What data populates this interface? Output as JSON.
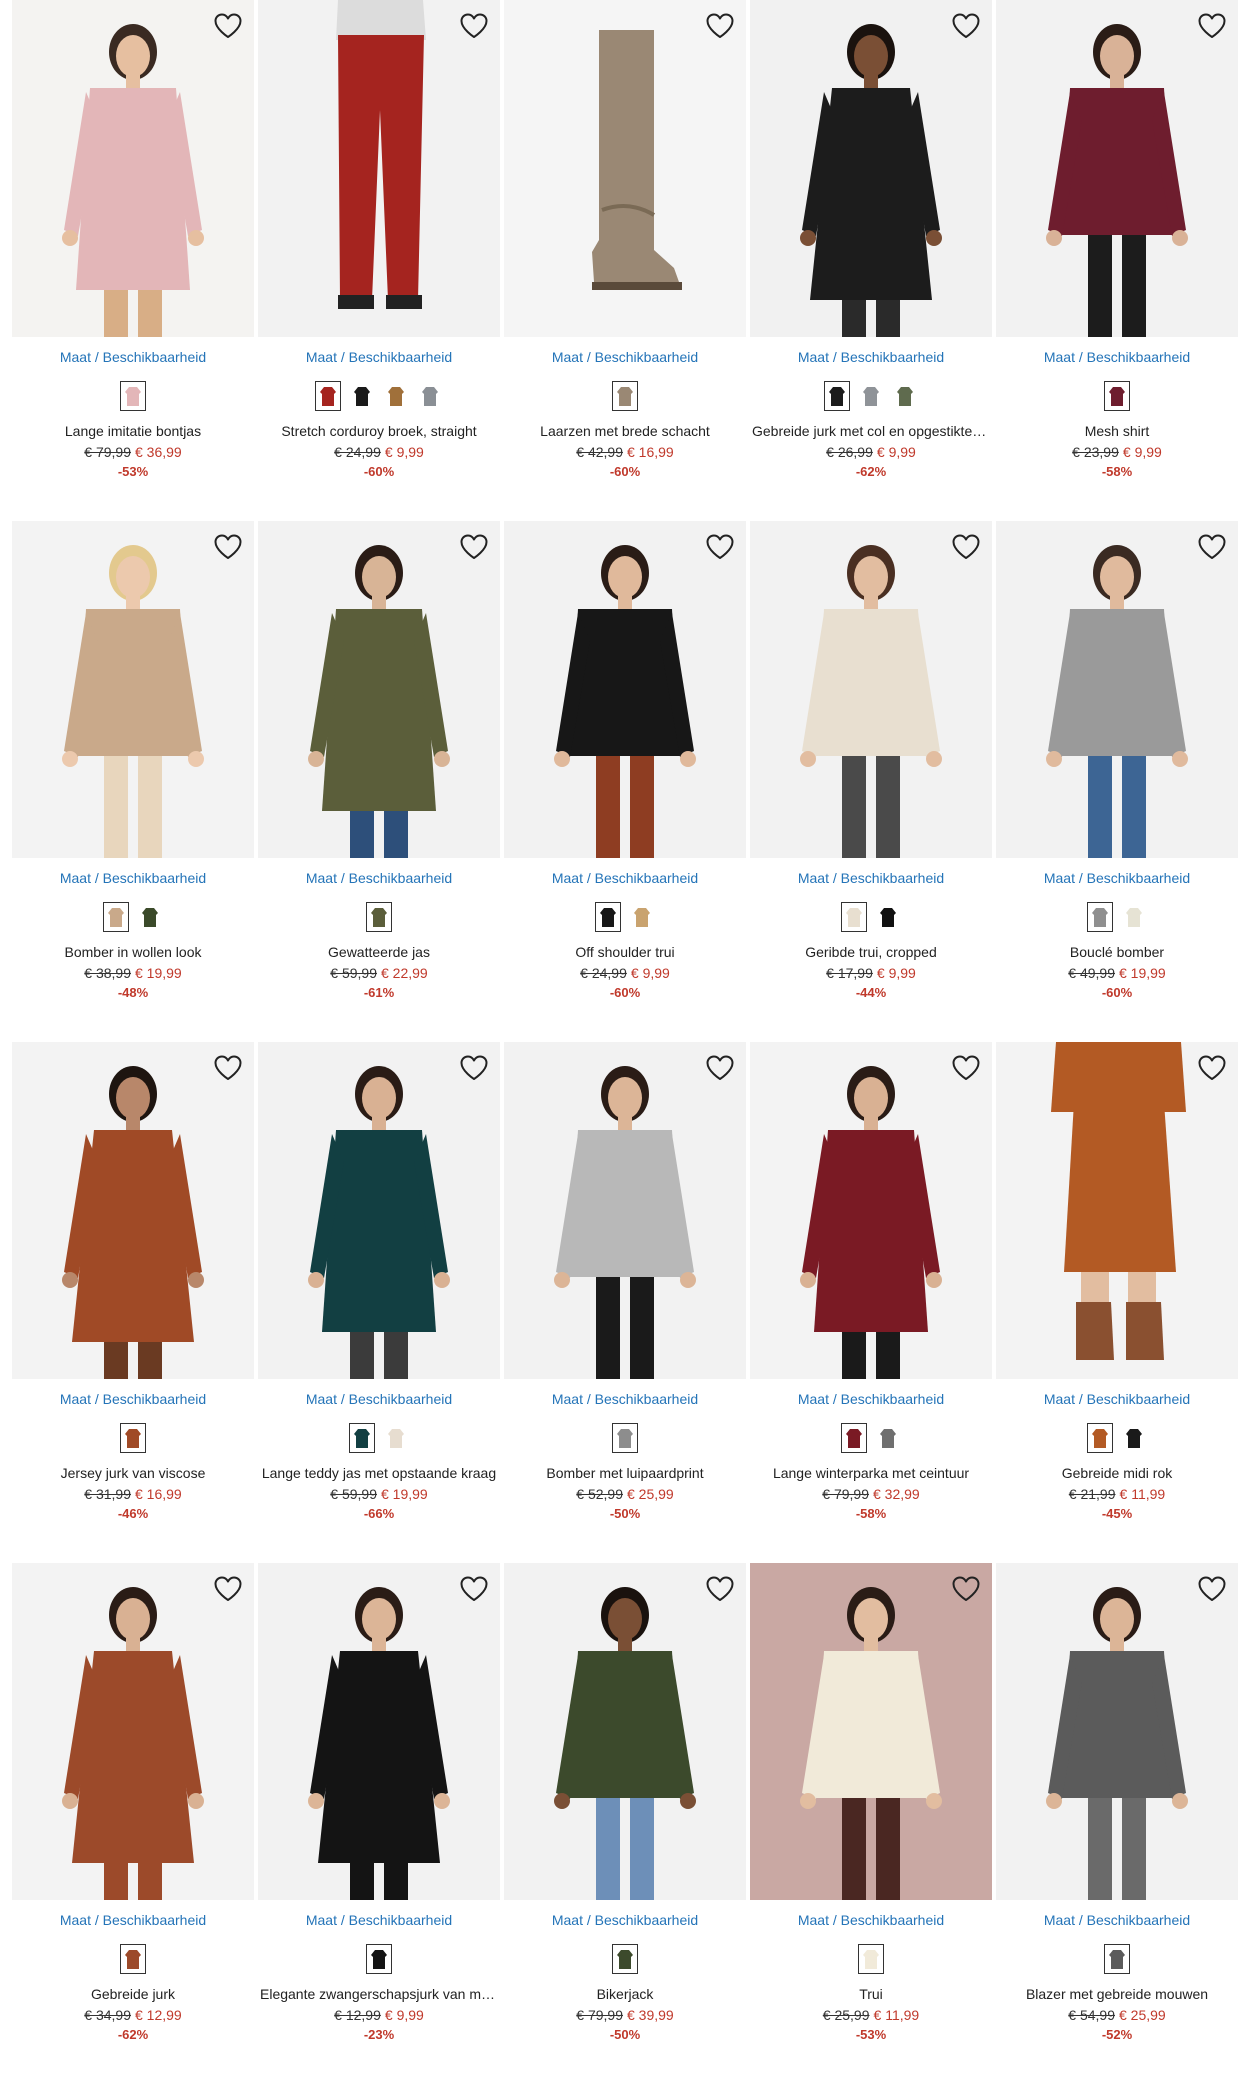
{
  "labels": {
    "sizes_link": "Maat / Beschikbaarheid"
  },
  "icons": {
    "wishlist": "heart-outline-icon"
  },
  "colors": {
    "link": "#2474b8",
    "sale": "#c0392b"
  },
  "products": [
    {
      "name": "Lange imitatie bontjas",
      "old_price": "€ 79,99",
      "new_price": "€ 36,99",
      "discount": "-53%",
      "bg": "#f4f3f1",
      "figure": "#e3b6b8",
      "legs": "#d8ae86",
      "skin": "#e6bfa0",
      "hair": "#3a2a22",
      "kind": "coat",
      "swatches": [
        "#e3b6b8"
      ]
    },
    {
      "name": "Stretch corduroy broek, straight",
      "old_price": "€ 24,99",
      "new_price": "€ 9,99",
      "discount": "-60%",
      "bg": "#f2f2f2",
      "figure": "#a5241f",
      "legs": "#a5241f",
      "skin": "#e2bfa3",
      "hair": "#2a2a2a",
      "kind": "pants",
      "swatches": [
        "#a5241f",
        "#1a1a1a",
        "#a0703a",
        "#8a8f95"
      ]
    },
    {
      "name": "Laarzen met brede schacht",
      "old_price": "€ 42,99",
      "new_price": "€ 16,99",
      "discount": "-60%",
      "bg": "#f5f5f5",
      "figure": "#9a8874",
      "legs": "#9a8874",
      "skin": "#9a8874",
      "hair": "#9a8874",
      "kind": "boot",
      "swatches": [
        "#9a8874"
      ]
    },
    {
      "name": "Gebreide jurk met col en opgestikte zak",
      "old_price": "€ 26,99",
      "new_price": "€ 9,99",
      "discount": "-62%",
      "bg": "#f1f1f1",
      "figure": "#1c1c1c",
      "legs": "#2a2a2a",
      "skin": "#7a4f35",
      "hair": "#1a120e",
      "kind": "dress",
      "swatches": [
        "#1c1c1c",
        "#8f9398",
        "#5f6b4e"
      ]
    },
    {
      "name": "Mesh shirt",
      "old_price": "€ 23,99",
      "new_price": "€ 9,99",
      "discount": "-58%",
      "bg": "#f2f2f2",
      "figure": "#6e1d2e",
      "legs": "#1c1c1c",
      "skin": "#d9b297",
      "hair": "#2a1c16",
      "kind": "top",
      "swatches": [
        "#6e1d2e"
      ]
    },
    {
      "name": "Bomber in wollen look",
      "old_price": "€ 38,99",
      "new_price": "€ 19,99",
      "discount": "-48%",
      "bg": "#f3f3f3",
      "figure": "#c9a98a",
      "legs": "#e8d6bd",
      "skin": "#ecc9ad",
      "hair": "#e3c98e",
      "kind": "jacket",
      "swatches": [
        "#c9a98a",
        "#3b4a2a"
      ]
    },
    {
      "name": "Gewatteerde jas",
      "old_price": "€ 59,99",
      "new_price": "€ 22,99",
      "discount": "-61%",
      "bg": "#f2f2f2",
      "figure": "#5b5e3a",
      "legs": "#2d4f7a",
      "skin": "#d8b496",
      "hair": "#2a1c16",
      "kind": "coat",
      "swatches": [
        "#5b5e3a"
      ]
    },
    {
      "name": "Off shoulder trui",
      "old_price": "€ 24,99",
      "new_price": "€ 9,99",
      "discount": "-60%",
      "bg": "#f2f2f2",
      "figure": "#171717",
      "legs": "#8e3d22",
      "skin": "#e0b99b",
      "hair": "#2a1c16",
      "kind": "top",
      "swatches": [
        "#171717",
        "#c9a36f"
      ]
    },
    {
      "name": "Geribde trui, cropped",
      "old_price": "€ 17,99",
      "new_price": "€ 9,99",
      "discount": "-44%",
      "bg": "#f2f2f2",
      "figure": "#e8dfd0",
      "legs": "#4a4a4a",
      "skin": "#e2bda0",
      "hair": "#4a2f22",
      "kind": "sweater",
      "swatches": [
        "#e8dfd0",
        "#111111"
      ]
    },
    {
      "name": "Bouclé bomber",
      "old_price": "€ 49,99",
      "new_price": "€ 19,99",
      "discount": "-60%",
      "bg": "#f2f2f2",
      "figure": "#9a9a9a",
      "legs": "#3d6594",
      "skin": "#e0ba9d",
      "hair": "#3a2a22",
      "kind": "jacket",
      "swatches": [
        "#8f8f8f",
        "#e6e3d4"
      ]
    },
    {
      "name": "Jersey jurk van viscose",
      "old_price": "€ 31,99",
      "new_price": "€ 16,99",
      "discount": "-46%",
      "bg": "#f3f3f3",
      "figure": "#a04a26",
      "legs": "#6a3a22",
      "skin": "#b8876a",
      "hair": "#1e1510",
      "kind": "dress",
      "swatches": [
        "#a04a26"
      ]
    },
    {
      "name": "Lange teddy jas met opstaande kraag",
      "old_price": "€ 59,99",
      "new_price": "€ 19,99",
      "discount": "-66%",
      "bg": "#f2f2f2",
      "figure": "#123f42",
      "legs": "#3b3b3b",
      "skin": "#d9b193",
      "hair": "#2a1c16",
      "kind": "coat",
      "swatches": [
        "#123f42",
        "#e7ddd0"
      ]
    },
    {
      "name": "Bomber met luipaardprint",
      "old_price": "€ 52,99",
      "new_price": "€ 25,99",
      "discount": "-50%",
      "bg": "#f2f2f2",
      "figure": "#b8b8b8",
      "legs": "#1a1a1a",
      "skin": "#dcb597",
      "hair": "#2a1c16",
      "kind": "jacket",
      "swatches": [
        "#8d8d8d"
      ]
    },
    {
      "name": "Lange winterparka met ceintuur",
      "old_price": "€ 79,99",
      "new_price": "€ 32,99",
      "discount": "-58%",
      "bg": "#f3f3f3",
      "figure": "#7a1a24",
      "legs": "#1a1a1a",
      "skin": "#d9b193",
      "hair": "#2a1c16",
      "kind": "coat",
      "swatches": [
        "#7a1a24",
        "#6f6f6f"
      ]
    },
    {
      "name": "Gebreide midi rok",
      "old_price": "€ 21,99",
      "new_price": "€ 11,99",
      "discount": "-45%",
      "bg": "#f3f3f3",
      "figure": "#b35a24",
      "legs": "#8a5030",
      "skin": "#b35a24",
      "hair": "#b35a24",
      "kind": "skirt",
      "swatches": [
        "#b35a24",
        "#1a1a1a"
      ]
    },
    {
      "name": "Gebreide jurk",
      "old_price": "€ 34,99",
      "new_price": "€ 12,99",
      "discount": "-62%",
      "bg": "#f3f3f3",
      "figure": "#9c4a2a",
      "legs": "#9c4a2a",
      "skin": "#d9b193",
      "hair": "#2a1c16",
      "kind": "dress",
      "swatches": [
        "#9c4a2a"
      ]
    },
    {
      "name": "Elegante zwangerschapsjurk van mesh",
      "old_price": "€ 12,99",
      "new_price": "€ 9,99",
      "discount": "-23%",
      "bg": "#f2f2f2",
      "figure": "#141414",
      "legs": "#141414",
      "skin": "#dcb597",
      "hair": "#2a1c16",
      "kind": "dress",
      "swatches": [
        "#141414"
      ]
    },
    {
      "name": "Bikerjack",
      "old_price": "€ 79,99",
      "new_price": "€ 39,99",
      "discount": "-50%",
      "bg": "#f2f2f2",
      "figure": "#3c4a2c",
      "legs": "#6d8fb8",
      "skin": "#7a4f35",
      "hair": "#1a120e",
      "kind": "jacket",
      "swatches": [
        "#3c4a2c"
      ]
    },
    {
      "name": "Trui",
      "old_price": "€ 25,99",
      "new_price": "€ 11,99",
      "discount": "-53%",
      "bg": "#c9a8a3",
      "figure": "#f1ead9",
      "legs": "#4a2722",
      "skin": "#e2bda0",
      "hair": "#2a1c16",
      "kind": "sweater",
      "swatches": [
        "#f1ead9"
      ]
    },
    {
      "name": "Blazer met gebreide mouwen",
      "old_price": "€ 54,99",
      "new_price": "€ 25,99",
      "discount": "-52%",
      "bg": "#f2f2f2",
      "figure": "#5b5b5b",
      "legs": "#6a6a6a",
      "skin": "#dcb597",
      "hair": "#2a1c16",
      "kind": "jacket",
      "swatches": [
        "#5b5b5b"
      ]
    }
  ]
}
